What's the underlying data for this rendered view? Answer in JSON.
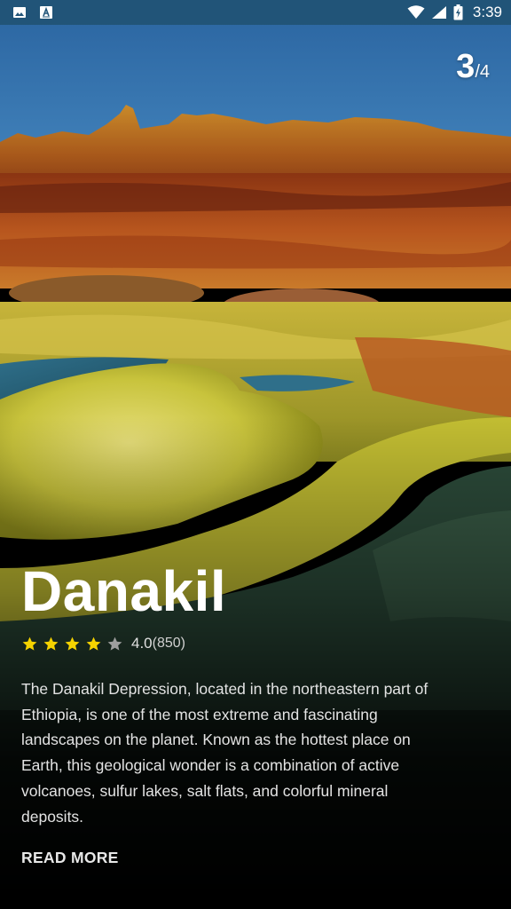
{
  "status_bar": {
    "time": "3:39",
    "left_icons": [
      "image-notification-icon",
      "text-notification-icon"
    ],
    "right_icons": [
      "wifi-icon",
      "cell-signal-icon",
      "battery-charging-icon"
    ],
    "background": "#215478"
  },
  "pager": {
    "current": "3",
    "total": "/4"
  },
  "place": {
    "title": "Danakil",
    "rating": {
      "stars": 4,
      "max_stars": 5,
      "value": "4.0",
      "count": "(850)",
      "filled_color": "#f5d300",
      "empty_color": "#9e9e9e"
    },
    "description": "The Danakil Depression, located in the northeastern part of Ethiopia, is one of the most extreme and fascinating landscapes on the planet. Known as the hottest place on Earth, this geological wonder is a combination of active volcanoes, sulfur lakes, salt flats, and colorful mineral deposits.",
    "read_more_label": "READ MORE"
  }
}
